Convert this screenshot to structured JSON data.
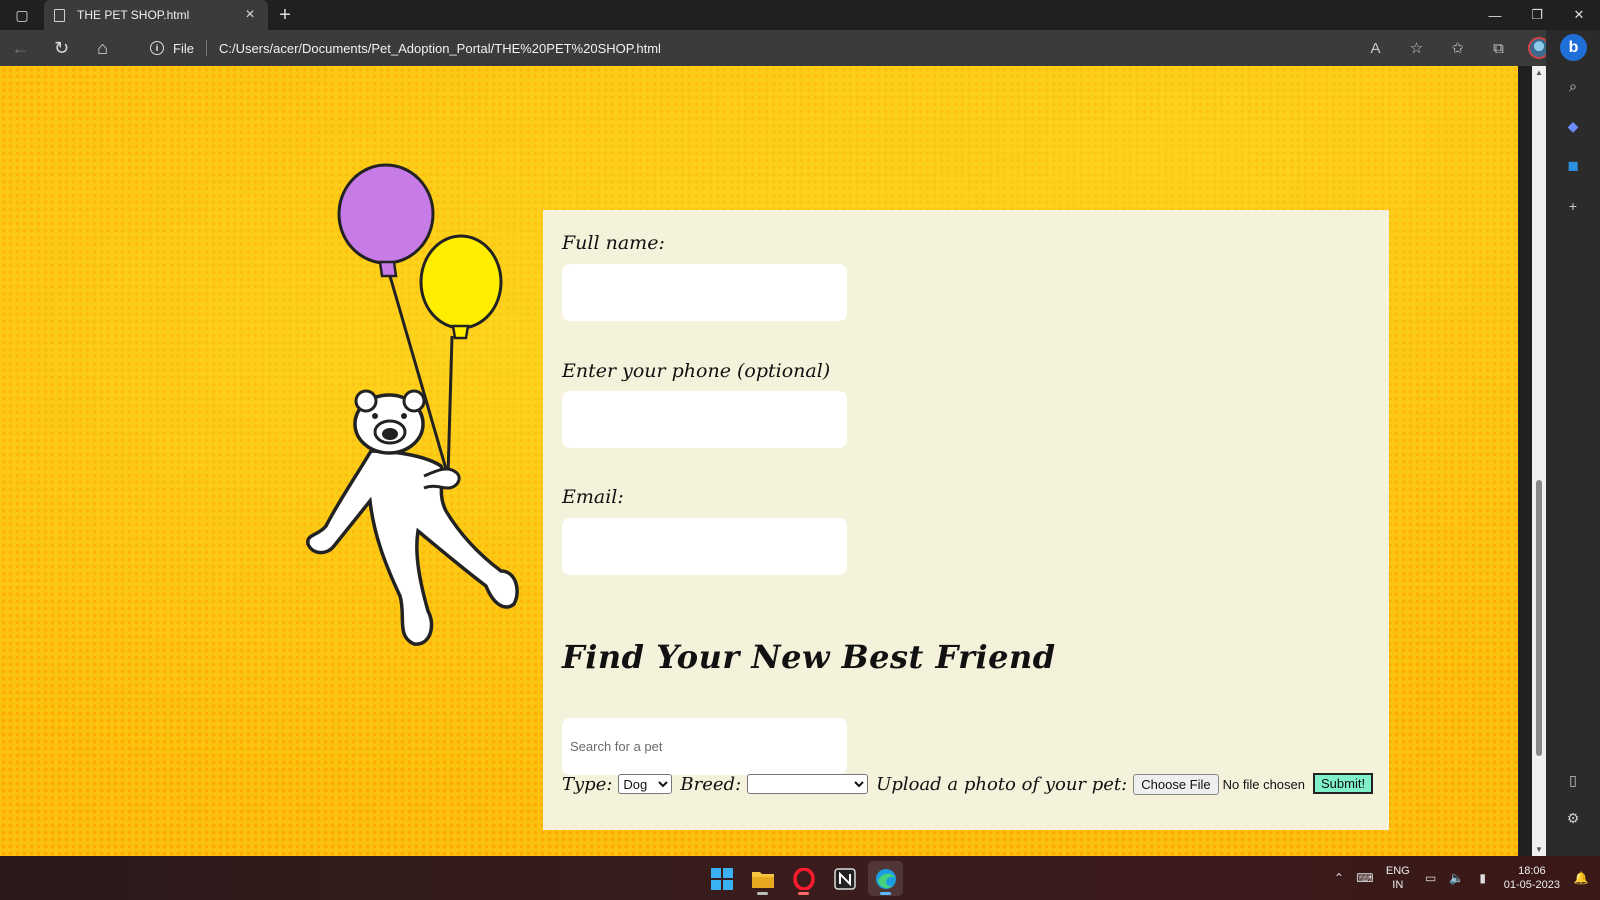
{
  "browser": {
    "tab_title": "THE PET SHOP.html",
    "url_scheme_label": "File",
    "url": "C:/Users/acer/Documents/Pet_Adoption_Portal/THE%20PET%20SHOP.html"
  },
  "form": {
    "full_name_label": "Full name:",
    "phone_label": "Enter your phone (optional)",
    "email_label": "Email:",
    "section_title": "Find Your New Best Friend",
    "search_placeholder": "Search for a pet",
    "type_label": "Type:",
    "type_selected": "Dog",
    "breed_label": "Breed:",
    "breed_selected": "",
    "upload_label": "Upload a photo of your pet:",
    "choose_file_label": "Choose File",
    "file_status": "No file chosen",
    "submit_label": "Submit!"
  },
  "taskbar": {
    "lang_line1": "ENG",
    "lang_line2": "IN",
    "time": "18:06",
    "date": "01-05-2023"
  },
  "colors": {
    "page_background": "#fbc10e",
    "card_background": "#f5f2dc",
    "submit_background": "#7ff0c8",
    "balloon_purple": "#c77be6",
    "balloon_yellow": "#ffee00"
  }
}
